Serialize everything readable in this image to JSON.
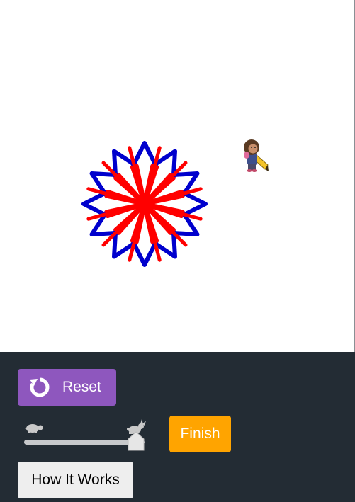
{
  "drawing": {
    "petal_count": 12,
    "outer_color": "#0000cd",
    "inner_color": "#ff0000",
    "artist_icon": "artist-character-icon"
  },
  "controls": {
    "reset_label": "Reset",
    "reset_icon": "refresh-icon",
    "finish_label": "Finish",
    "how_label": "How It Works",
    "speed": {
      "slow_icon": "turtle-icon",
      "fast_icon": "rabbit-icon",
      "level": 1.0
    }
  },
  "colors": {
    "panel_bg": "#232c34",
    "reset_bg": "#8e57be",
    "finish_bg": "#ffa400",
    "how_bg": "#eeeeee",
    "slider_track": "#c7c9cb"
  }
}
